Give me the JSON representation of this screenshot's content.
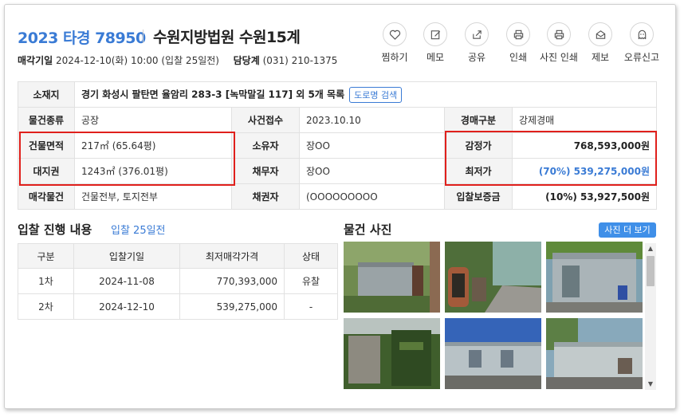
{
  "header": {
    "case_number": "2023 타경 78950",
    "court": "수원지방법원 수원15계",
    "sale_date_label": "매각기일",
    "sale_date_value": "2024-12-10(화) 10:00 (입찰 25일전)",
    "dept_label": "담당계",
    "dept_phone": "(031) 210-1375"
  },
  "actions": [
    {
      "label": "찜하기",
      "icon": "heart-icon"
    },
    {
      "label": "메모",
      "icon": "memo-icon"
    },
    {
      "label": "공유",
      "icon": "share-icon"
    },
    {
      "label": "인쇄",
      "icon": "print-icon"
    },
    {
      "label": "사진 인쇄",
      "icon": "photo-print-icon"
    },
    {
      "label": "제보",
      "icon": "report-mail-icon"
    },
    {
      "label": "오류신고",
      "icon": "ghost-alert-icon"
    }
  ],
  "info": {
    "location_label": "소재지",
    "location_value": "경기 화성시 팔탄면 율암리 283-3 [녹막말길 117] 외 5개 목록",
    "road_search": "도로명 검색",
    "type_label": "물건종류",
    "type_value": "공장",
    "filed_label": "사건접수",
    "filed_value": "2023.10.10",
    "auction_type_label": "경매구분",
    "auction_type_value": "강제경매",
    "building_label": "건물면적",
    "building_value": "217㎡ (65.64평)",
    "owner_label": "소유자",
    "owner_value": "장OO",
    "appraisal_label": "감정가",
    "appraisal_value": "768,593,000원",
    "land_label": "대지권",
    "land_value": "1243㎡ (376.01평)",
    "debtor_label": "채무자",
    "debtor_value": "장OO",
    "minimum_label": "최저가",
    "minimum_value": "(70%) 539,275,000원",
    "sale_item_label": "매각물건",
    "sale_item_value": "건물전부, 토지전부",
    "creditor_label": "채권자",
    "creditor_value": "(OOOOOOOOO",
    "deposit_label": "입찰보증금",
    "deposit_value": "(10%) 53,927,500원"
  },
  "bid_section": {
    "title": "입찰 진행 내용",
    "sub": "입찰 25일전",
    "columns": [
      "구분",
      "입찰기일",
      "최저매각가격",
      "상태"
    ],
    "rows": [
      [
        "1차",
        "2024-11-08",
        "770,393,000",
        "유찰"
      ],
      [
        "2차",
        "2024-12-10",
        "539,275,000",
        "-"
      ]
    ]
  },
  "photo_section": {
    "title": "물건 사진",
    "more": "사진 더 보기"
  },
  "colors": {
    "accent_blue": "#3a7bd5",
    "highlight_red": "#e0201c",
    "header_gray": "#f4f4f4"
  }
}
